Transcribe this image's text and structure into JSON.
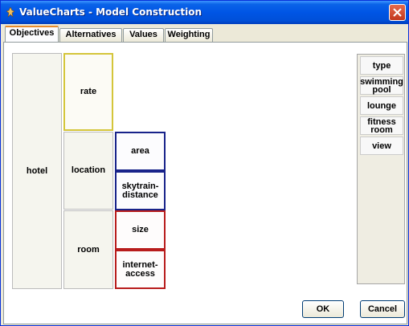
{
  "window": {
    "title": "ValueCharts - Model Construction"
  },
  "tabs": [
    "Objectives",
    "Alternatives",
    "Values",
    "Weighting"
  ],
  "objectives": {
    "root": "hotel",
    "level1": [
      "rate",
      "location",
      "room"
    ],
    "level2": [
      "area",
      "skytrain-\ndistance",
      "size",
      "internet-\naccess"
    ]
  },
  "palette": [
    "type",
    "swimming\npool",
    "lounge",
    "fitness\nroom",
    "view"
  ],
  "buttons": {
    "ok": "OK",
    "cancel": "Cancel"
  },
  "colors": {
    "rate_border": "#d4c53a",
    "location_children_border": "#18238a",
    "room_children_border": "#b81c1c",
    "titlebar": "#0055e5"
  }
}
